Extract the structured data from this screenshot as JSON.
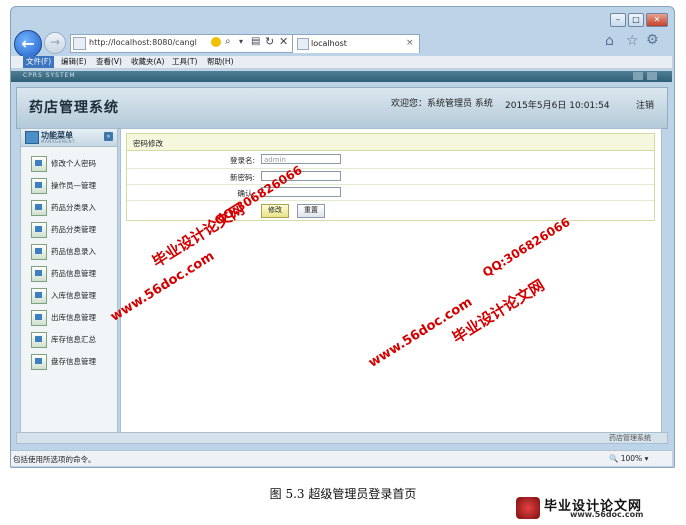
{
  "browser": {
    "address": "http://localhost:8080/cangl",
    "tab_title": "localhost",
    "tab_close": "×",
    "menu": [
      "文件(F)",
      "编辑(E)",
      "查看(V)",
      "收藏夹(A)",
      "工具(T)",
      "帮助(H)"
    ],
    "status": "包括使用所选项的命令。",
    "zoom": "100%"
  },
  "app": {
    "sys_label": "CPRS SYSTEM",
    "title": "药店管理系统",
    "welcome": "欢迎您：系统管理员 系统",
    "datetime": "2015年5月6日  10:01:54",
    "logout": "注销",
    "sidebar": {
      "title": "功能菜单",
      "subtitle": "MANAGEMENT",
      "toggle": "»",
      "items": [
        "修改个人密码",
        "操作员—管理",
        "药品分类录入",
        "药品分类管理",
        "药品信息录入",
        "药品信息管理",
        "入库信息管理",
        "出库信息管理",
        "库存信息汇总",
        "盘存信息管理"
      ]
    },
    "panel": {
      "title": "密码修改",
      "username_label": "登录名:",
      "username_value": "admin",
      "new_pwd_label": "新密码:",
      "confirm_label": "确认:",
      "submit": "修改",
      "reset": "重置"
    },
    "footer": "药店管理系统"
  },
  "watermarks": {
    "brand": "毕业设计论文网",
    "qq": "QQ:306826066",
    "site": "www.56doc.com"
  },
  "caption": "图 5.3  超级管理员登录首页",
  "logo": {
    "text": "毕业设计论文网",
    "url": "www.56doc.com"
  },
  "colors": {
    "watermark": "#d40000",
    "accent": "#3c76c0"
  }
}
